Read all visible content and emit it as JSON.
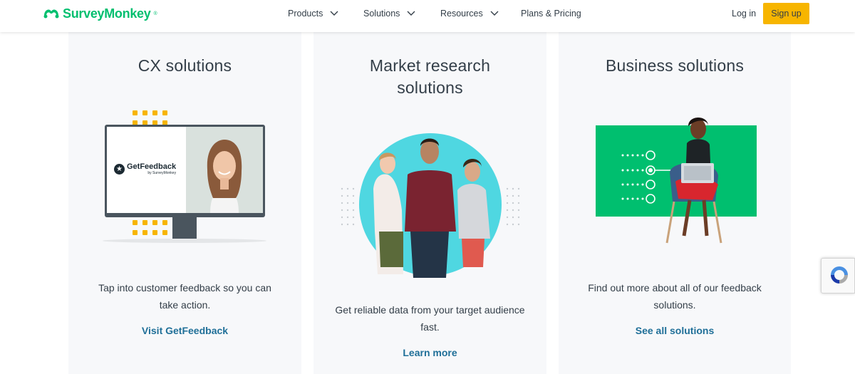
{
  "header": {
    "brand": "SurveyMonkey",
    "nav": [
      {
        "label": "Products"
      },
      {
        "label": "Solutions"
      },
      {
        "label": "Resources"
      },
      {
        "label": "Plans & Pricing"
      }
    ],
    "login": "Log in",
    "signup": "Sign up"
  },
  "cards": [
    {
      "title": "CX solutions",
      "description": "Tap into customer feedback so you can take action.",
      "link": "Visit GetFeedback",
      "screen_brand": "GetFeedback",
      "screen_sub": "by SurveyMonkey"
    },
    {
      "title": "Market research solutions",
      "description": "Get reliable data from your target audience fast.",
      "link": "Learn more"
    },
    {
      "title": "Business solutions",
      "description": "Find out more about all of our feedback solutions.",
      "link": "See all solutions"
    }
  ],
  "colors": {
    "brand_green": "#00bf6f",
    "accent_yellow": "#f7b500",
    "link_blue": "#1f6f98",
    "card_bg": "#f7f8fa",
    "teal": "#4fd7e1"
  },
  "icons": [
    "surveymonkey-logo-icon",
    "chevron-down-icon",
    "recaptcha-icon"
  ]
}
